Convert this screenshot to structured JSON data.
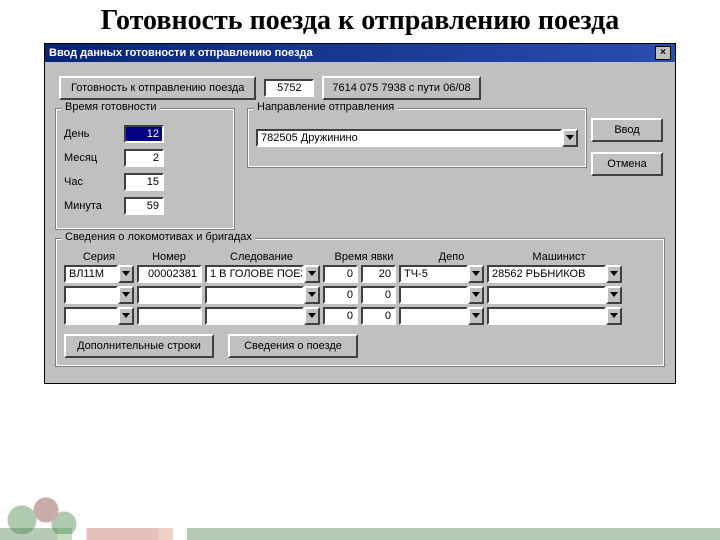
{
  "slide": {
    "title": "Готовность поезда к отправлению поезда"
  },
  "window": {
    "title": "Ввод данных готовности к отправлению поезда",
    "close": "×"
  },
  "header": {
    "panel_label": "Готовность к отправлению поезда",
    "num": "5752",
    "route": "7614 075 7938 с пути 06/08"
  },
  "buttons": {
    "enter": "Ввод",
    "cancel": "Отмена",
    "extra_rows": "Дополнительные строки",
    "train_info": "Сведения о поезде"
  },
  "ready_time": {
    "legend": "Время готовности",
    "day_label": "День",
    "day": "12",
    "month_label": "Месяц",
    "month": "2",
    "hour_label": "Час",
    "hour": "15",
    "minute_label": "Минута",
    "minute": "59"
  },
  "direction": {
    "legend": "Направление отправления",
    "value": "782505 Дружинино"
  },
  "loco": {
    "legend": "Сведения о локомотивах и бригадах",
    "cols": {
      "series": "Серия",
      "number": "Номер",
      "follow": "Следование",
      "arrive": "Время явки",
      "depot": "Депо",
      "driver": "Машинист"
    },
    "rows": [
      {
        "series": "ВЛ11М",
        "number": "00002381",
        "follow": "1 В ГОЛОВЕ ПОЕЗ",
        "t1": "0",
        "t2": "20",
        "depot": "ТЧ-5",
        "driver": "28562 РЬБНИКОВ"
      },
      {
        "series": "",
        "number": "",
        "follow": "",
        "t1": "0",
        "t2": "0",
        "depot": "",
        "driver": ""
      },
      {
        "series": "",
        "number": "",
        "follow": "",
        "t1": "0",
        "t2": "0",
        "depot": "",
        "driver": ""
      }
    ]
  }
}
